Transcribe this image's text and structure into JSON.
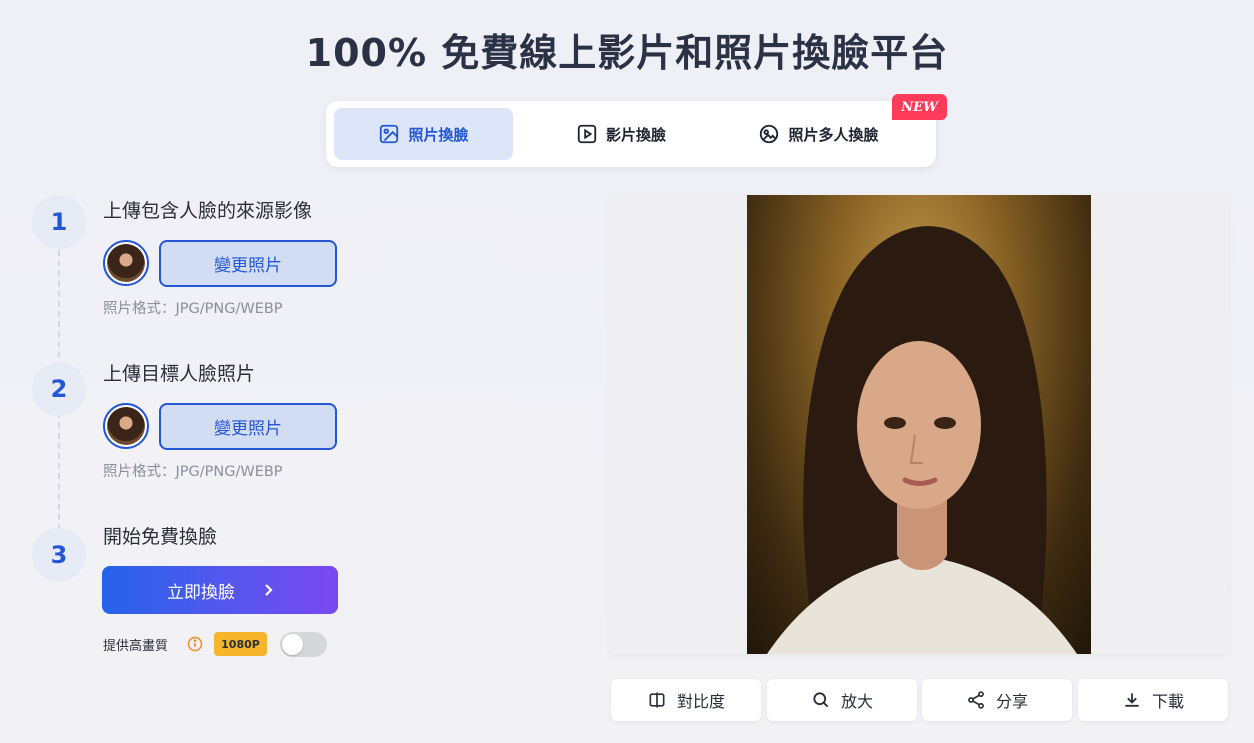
{
  "page": {
    "title": "100% 免費線上影片和照片換臉平台"
  },
  "tabs": [
    {
      "label": "照片換臉",
      "icon": "image-icon",
      "active": true
    },
    {
      "label": "影片換臉",
      "icon": "play-icon",
      "active": false
    },
    {
      "label": "照片多人換臉",
      "icon": "multi-image-icon",
      "active": false
    }
  ],
  "new_badge": "NEW",
  "steps": {
    "step1": {
      "number": "1",
      "title": "上傳包含人臉的來源影像",
      "button": "變更照片",
      "format": "照片格式：JPG/PNG/WEBP"
    },
    "step2": {
      "number": "2",
      "title": "上傳目標人臉照片",
      "button": "變更照片",
      "format": "照片格式：JPG/PNG/WEBP"
    },
    "step3": {
      "number": "3",
      "title": "開始免費換臉",
      "button": "立即換臉",
      "button_icon": "chevron-right-icon"
    }
  },
  "hq": {
    "label": "提供高畫質",
    "resolution": "1080P",
    "enabled": false
  },
  "actions": [
    {
      "label": "對比度",
      "icon": "compare-icon"
    },
    {
      "label": "放大",
      "icon": "search-icon"
    },
    {
      "label": "分享",
      "icon": "share-icon"
    },
    {
      "label": "下載",
      "icon": "download-icon"
    }
  ],
  "colors": {
    "accent": "#2457d6",
    "badge": "#ff3b5c",
    "resolution_badge": "#f7b52b"
  }
}
